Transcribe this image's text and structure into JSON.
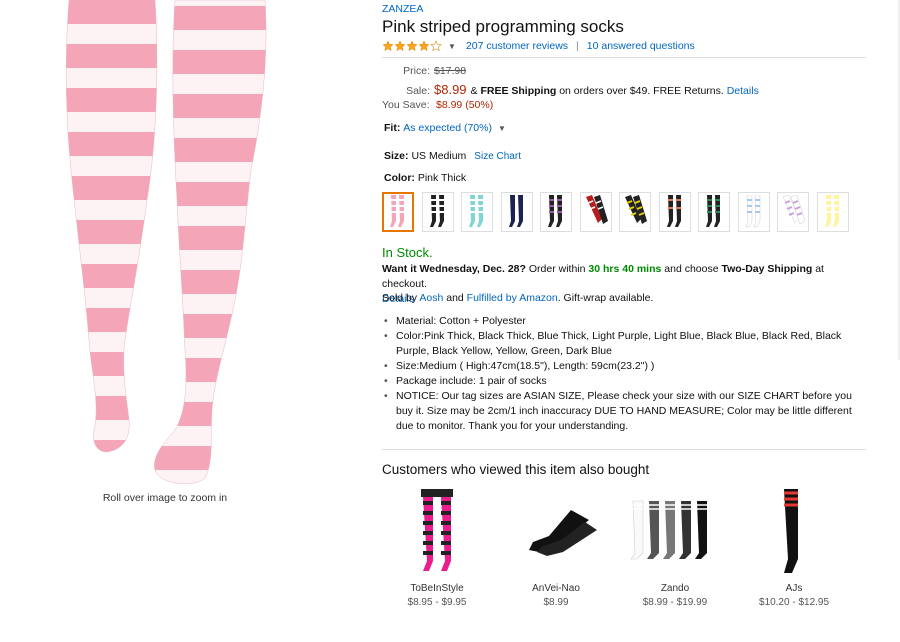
{
  "product": {
    "brand": "ZANZEA",
    "title": "Pink striped programming socks",
    "rating_stars": 4,
    "reviews": "207 customer reviews",
    "answered": "10 answered questions"
  },
  "pricing": {
    "price_label": "Price:",
    "list_price": "$17.98",
    "sale_label": "Sale:",
    "sale_price": "$8.99",
    "shipping_prefix": "& ",
    "free_shipping": "FREE Shipping",
    "shipping_suffix": " on orders over $49.  FREE Returns.",
    "details_link": "Details",
    "save_label": "You Save:",
    "save_value": "$8.99 (50%)"
  },
  "fit": {
    "label": "Fit:",
    "value": "As expected (70%)"
  },
  "size": {
    "label": "Size:",
    "value": "US Medium",
    "chart_link": "Size Chart"
  },
  "color": {
    "label": "Color:",
    "value": "Pink Thick"
  },
  "availability": {
    "stock": "In Stock.",
    "want_it": "Want it Wednesday, Dec. 28?",
    "order_within": " Order within ",
    "countdown": "30 hrs 40 mins",
    "choose": " and choose ",
    "two_day": "Two-Day Shipping",
    "at_checkout": " at checkout.",
    "details_link": "Details",
    "sold_by_prefix": "Sold by ",
    "seller": "Aosh",
    "and": " and ",
    "fulfilled": "Fulfilled by Amazon",
    "gift": ". Gift-wrap available."
  },
  "bullets": [
    "Material: Cotton + Polyester",
    "Color:Pink Thick, Black Thick, Blue Thick, Light Purple, Light Blue, Black Blue, Black Red, Black Purple, Black Yellow, Yellow, Green, Dark Blue",
    "Size:Medium ( High:47cm(18.5\"), Length: 59cm(23.2\") )",
    "Package include: 1 pair of socks",
    "NOTICE: Our tag sizes are ASIAN SIZE, Please check your size with our SIZE CHART before you buy it. Size may be 2cm/1 inch inaccuracy DUE TO HAND MEASURE; Color may be little different due to monitor. Thank you for your understanding."
  ],
  "zoom_hint": "Roll over image to zoom in",
  "also_bought": {
    "title": "Customers who viewed this item also bought",
    "items": [
      {
        "name": "ToBeInStyle",
        "price": "$8.95 - $9.95"
      },
      {
        "name": "AnVei-Nao",
        "price": "$8.99"
      },
      {
        "name": "Zando",
        "price": "$8.99 - $19.99"
      },
      {
        "name": "AJs",
        "price": "$10.20 - $12.95"
      }
    ]
  },
  "colors": {
    "link": "#0066c0",
    "price_red": "#b12704",
    "stock_green": "#008a00",
    "star": "#ffa41c",
    "sock_pink": "#f4a6b8",
    "selected_border": "#e77600"
  }
}
